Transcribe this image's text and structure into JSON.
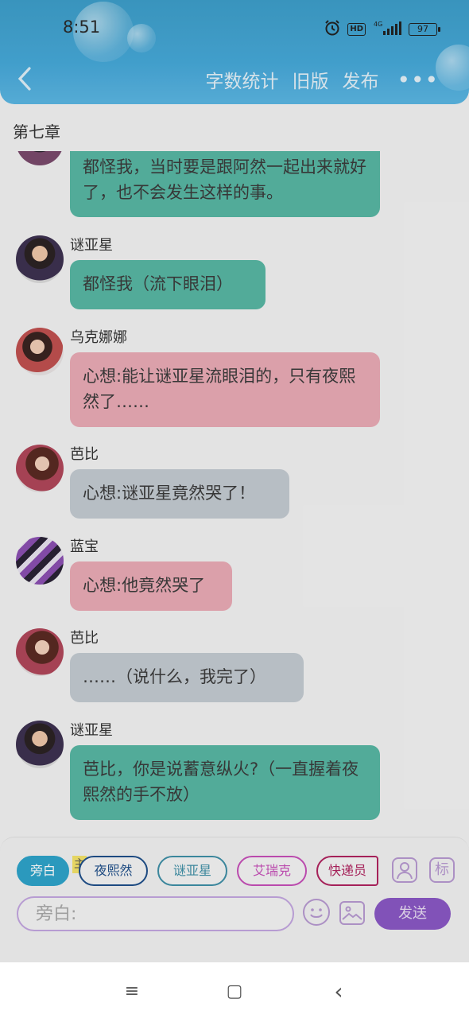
{
  "status": {
    "time": "8:51",
    "battery": "97",
    "network": "4G"
  },
  "header": {
    "back": "‹",
    "actions": [
      "字数统计",
      "旧版",
      "发布"
    ],
    "more": "•••"
  },
  "chapter_title": "第七章",
  "messages": [
    {
      "name": "",
      "text": "都怪我，当时要是跟阿然一起出来就好了，也不会发生这样的事。",
      "color": "teal"
    },
    {
      "name": "谜亚星",
      "text": "都怪我（流下眼泪）",
      "color": "teal"
    },
    {
      "name": "乌克娜娜",
      "text": "心想:能让谜亚星流眼泪的，只有夜熙然了……",
      "color": "pink"
    },
    {
      "name": "芭比",
      "text": "心想:谜亚星竟然哭了！",
      "color": "grey"
    },
    {
      "name": "蓝宝",
      "text": "心想:他竟然哭了",
      "color": "pink"
    },
    {
      "name": "芭比",
      "text": "……（说什么，我完了）",
      "color": "grey"
    },
    {
      "name": "谜亚星",
      "text": "芭比，你是说蓄意纵火?（一直握着夜熙然的手不放）",
      "color": "teal"
    }
  ],
  "characters": [
    {
      "label": "旁白",
      "color": "#2ea3c9"
    },
    {
      "label": "夜熙然",
      "color": "#1f4f8a"
    },
    {
      "label": "谜亚星",
      "color": "#3f8fa6"
    },
    {
      "label": "艾瑞克",
      "color": "#c64fb8"
    },
    {
      "label": "快递员",
      "color": "#b0245f"
    }
  ],
  "main_badge": "主",
  "side_icons": {
    "person": "person-icon",
    "tag_label": "标"
  },
  "input": {
    "placeholder": "旁白:"
  },
  "send_label": "发送",
  "sysnav": {
    "menu": "≡",
    "home": "▢",
    "back": "‹"
  }
}
